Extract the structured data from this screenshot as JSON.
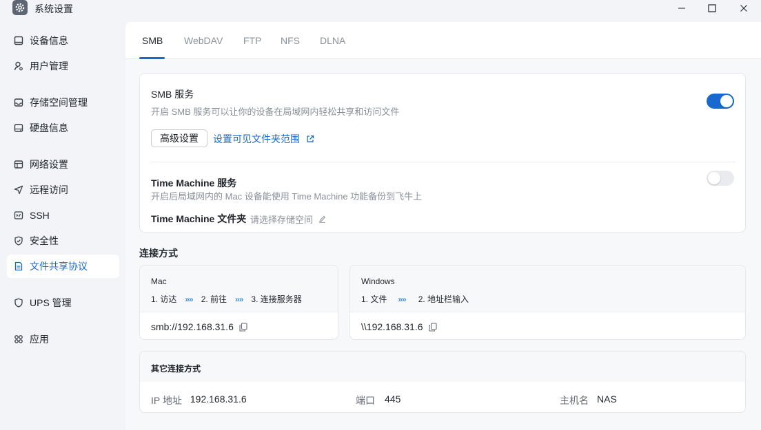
{
  "window": {
    "title": "系统设置",
    "controls": [
      "minimize",
      "maximize",
      "close"
    ]
  },
  "sidebar": {
    "items": [
      {
        "label": "设备信息",
        "icon": "device-icon"
      },
      {
        "label": "用户管理",
        "icon": "user-icon"
      },
      {
        "label": "存储空间管理",
        "icon": "storage-icon"
      },
      {
        "label": "硬盘信息",
        "icon": "disk-icon"
      },
      {
        "label": "网络设置",
        "icon": "network-icon"
      },
      {
        "label": "远程访问",
        "icon": "remote-icon"
      },
      {
        "label": "SSH",
        "icon": "terminal-icon"
      },
      {
        "label": "安全性",
        "icon": "shield-icon"
      },
      {
        "label": "文件共享协议",
        "icon": "document-icon",
        "active": true
      },
      {
        "label": "UPS 管理",
        "icon": "ups-icon"
      },
      {
        "label": "应用",
        "icon": "apps-icon"
      }
    ]
  },
  "tabs": [
    {
      "label": "SMB",
      "active": true
    },
    {
      "label": "WebDAV"
    },
    {
      "label": "FTP"
    },
    {
      "label": "NFS"
    },
    {
      "label": "DLNA"
    }
  ],
  "smb": {
    "title": "SMB 服务",
    "description": "开启 SMB 服务可以让你的设备在局域网内轻松共享和访问文件",
    "enabled": true,
    "advanced_button": "高级设置",
    "visible_folder_link": "设置可见文件夹范围"
  },
  "time_machine": {
    "title": "Time Machine 服务",
    "description": "开启后局域网内的 Mac 设备能使用 Time Machine 功能备份到飞牛上",
    "enabled": false,
    "folder_label": "Time Machine 文件夹",
    "folder_placeholder": "请选择存储空间"
  },
  "connection": {
    "title": "连接方式",
    "mac": {
      "name": "Mac",
      "steps": [
        "1. 访达",
        "2. 前往",
        "3. 连接服务器"
      ],
      "address": "smb://192.168.31.6"
    },
    "windows": {
      "name": "Windows",
      "steps": [
        "1. 文件",
        "2. 地址栏输入"
      ],
      "address": "\\\\192.168.31.6"
    },
    "step_separator": "»»"
  },
  "other": {
    "title": "其它连接方式",
    "ip_label": "IP 地址",
    "ip_value": "192.168.31.6",
    "port_label": "端口",
    "port_value": "445",
    "host_label": "主机名",
    "host_value": "NAS"
  },
  "colors": {
    "accent": "#1769cf",
    "toggle_off": "#e9ebef"
  }
}
